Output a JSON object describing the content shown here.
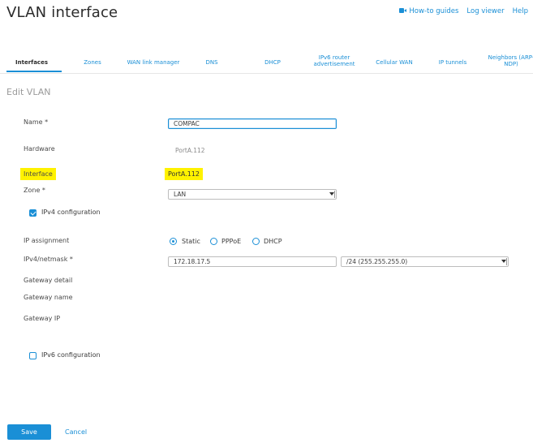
{
  "page": {
    "title": "VLAN interface",
    "section_title": "Edit VLAN"
  },
  "top_links": {
    "howto": "How-to guides",
    "log_viewer": "Log viewer",
    "help": "Help"
  },
  "tabs": [
    {
      "label": "Interfaces"
    },
    {
      "label": "Zones"
    },
    {
      "label": "WAN link manager"
    },
    {
      "label": "DNS"
    },
    {
      "label": "DHCP"
    },
    {
      "label": "IPv6 router advertisement"
    },
    {
      "label": "Cellular WAN"
    },
    {
      "label": "IP tunnels"
    },
    {
      "label": "Neighbors (ARP-NDP)"
    }
  ],
  "form": {
    "name_label": "Name *",
    "name_value": "COMPAC",
    "hardware_label": "Hardware",
    "hardware_value": "PortA.112",
    "interface_label": "Interface",
    "interface_value": "PortA.112",
    "zone_label": "Zone *",
    "zone_value": "LAN",
    "ipv4_config_label": "IPv4 configuration",
    "ipv4_config_checked": true,
    "ip_assignment_label": "IP assignment",
    "ip_options": [
      "Static",
      "PPPoE",
      "DHCP"
    ],
    "ip_selected": "Static",
    "ipv4_netmask_label": "IPv4/netmask *",
    "ipv4_value": "172.18.17.5",
    "netmask_value": "/24 (255.255.255.0)",
    "gateway_detail_label": "Gateway detail",
    "gateway_name_label": "Gateway name",
    "gateway_ip_label": "Gateway IP",
    "ipv6_config_label": "IPv6 configuration",
    "ipv6_config_checked": false
  },
  "actions": {
    "save": "Save",
    "cancel": "Cancel"
  },
  "colors": {
    "accent": "#1a8fd6",
    "highlight": "#fff200"
  }
}
